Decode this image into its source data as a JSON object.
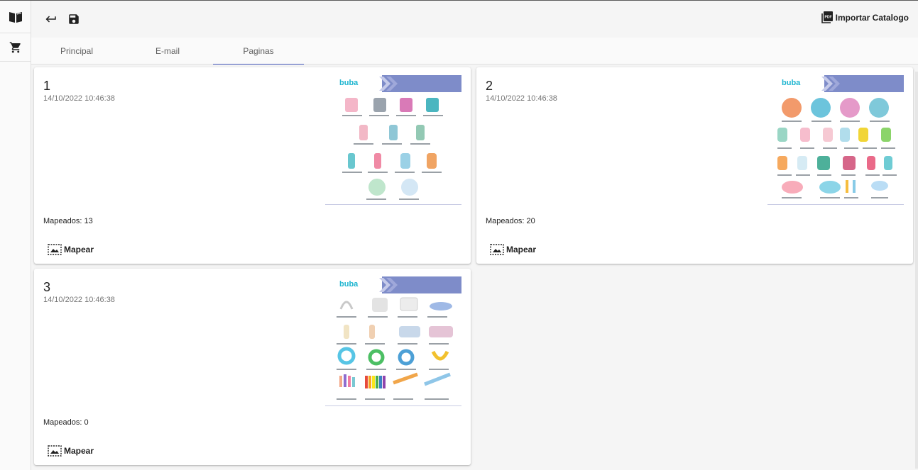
{
  "rail": {
    "items": [
      {
        "icon": "book-open-icon"
      },
      {
        "icon": "cart-icon"
      }
    ]
  },
  "toolbar": {
    "back_icon": "undo-arrow-icon",
    "save_icon": "floppy-save-icon",
    "import_label": "Importar Catalogo",
    "import_icon": "pdf-file-icon"
  },
  "tabs": [
    {
      "label": "Principal"
    },
    {
      "label": "E-mail"
    },
    {
      "label": "Paginas",
      "active": true
    }
  ],
  "pages": [
    {
      "number": "1",
      "date": "14/10/2022 10:46:38",
      "mapped": "Mapeados: 13",
      "map_label": "Mapear",
      "thumb_logo": "buba"
    },
    {
      "number": "2",
      "date": "14/10/2022 10:46:38",
      "mapped": "Mapeados: 20",
      "map_label": "Mapear",
      "thumb_logo": "buba"
    },
    {
      "number": "3",
      "date": "14/10/2022 10:46:38",
      "mapped": "Mapeados: 0",
      "map_label": "Mapear",
      "thumb_logo": "buba"
    }
  ],
  "colors": {
    "accent": "#3f51b5",
    "thumb_header": "#7e8cc9",
    "brand_logo": "#1eb5d0"
  }
}
